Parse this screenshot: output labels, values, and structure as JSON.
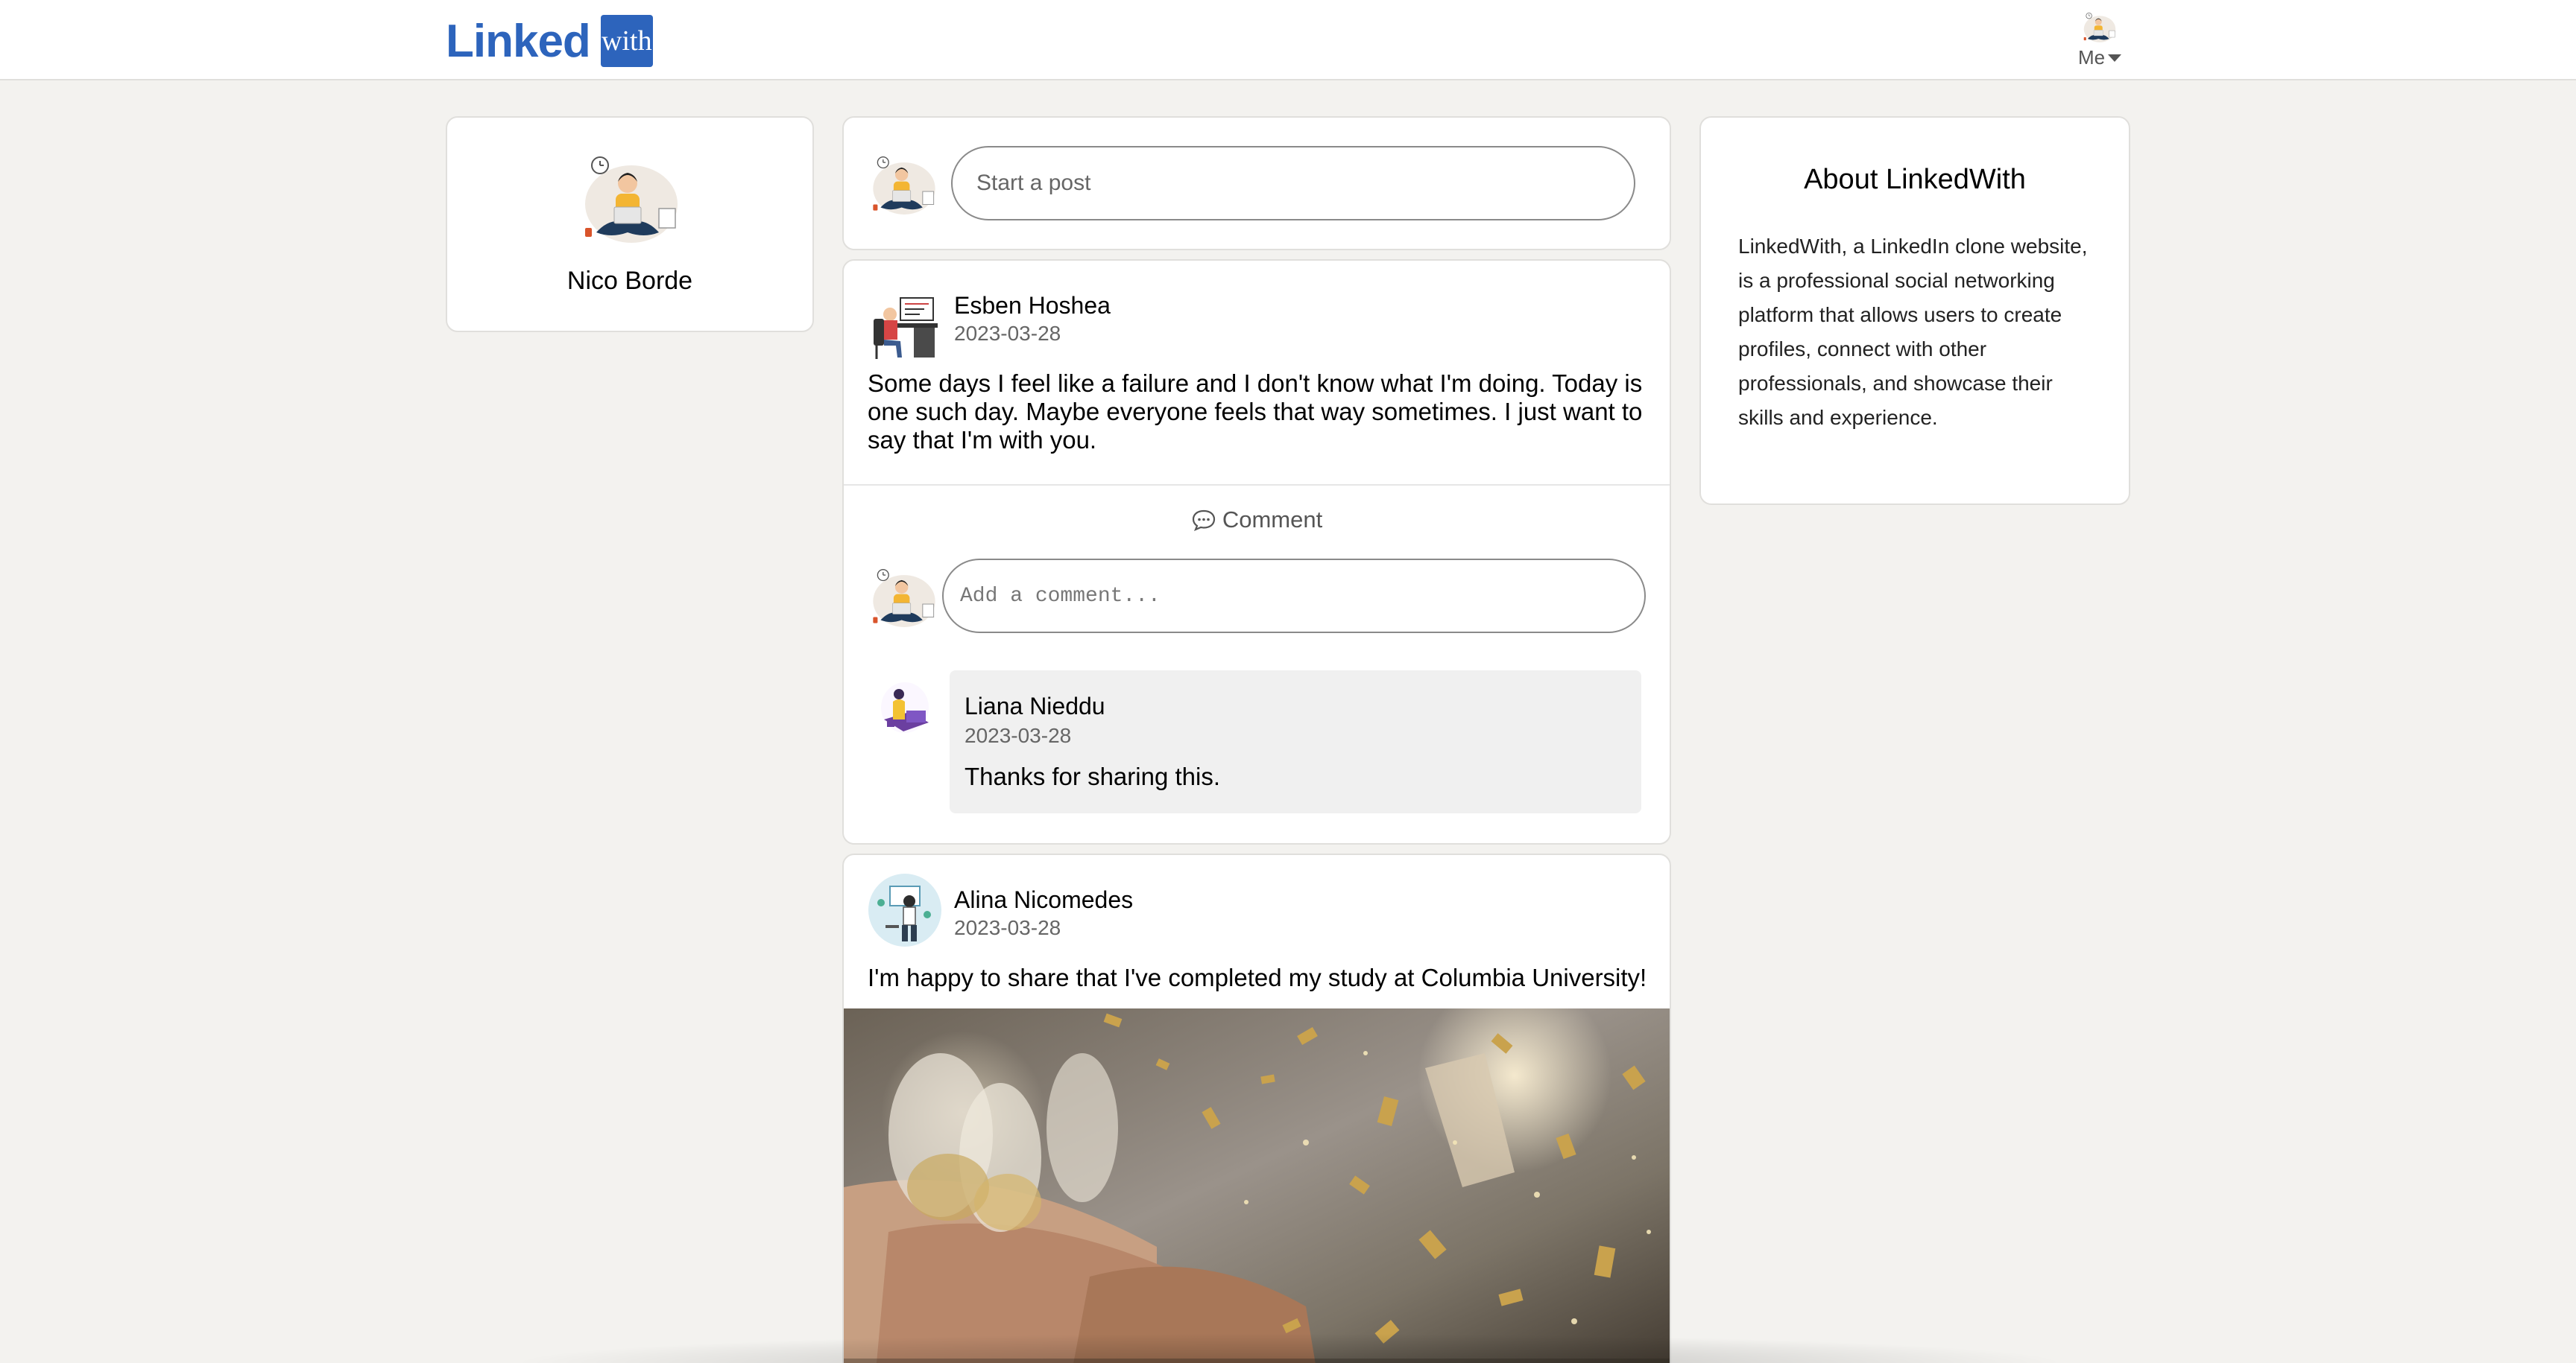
{
  "header": {
    "logo_word": "Linked",
    "logo_box": "with",
    "me_label": "Me",
    "me_icon": "caret-down-icon"
  },
  "profile": {
    "name": "Nico Borde"
  },
  "composer": {
    "placeholder": "Start a post"
  },
  "about": {
    "title": "About LinkedWith",
    "text": "LinkedWith, a LinkedIn clone website, is a professional social networking platform that allows users to create profiles, connect with other professionals, and showcase their skills and experience."
  },
  "posts": [
    {
      "author": "Esben Hoshea",
      "date": "2023-03-28",
      "body": "Some days I feel like a failure and I don't know what I'm doing. Today is one such day. Maybe everyone feels that way sometimes. I just want to say that I'm with you.",
      "comment_label": "Comment",
      "comment_icon": "speech-bubble-icon",
      "comment_placeholder": "Add a comment...",
      "comments": [
        {
          "author": "Liana Nieddu",
          "date": "2023-03-28",
          "text": "Thanks for sharing this."
        }
      ]
    },
    {
      "author": "Alina Nicomedes",
      "date": "2023-03-28",
      "body": "I'm happy to share that I've completed my study at Columbia University!"
    }
  ],
  "colors": {
    "brand": "#2d64bc",
    "background": "#f3f2ef",
    "card": "#ffffff"
  }
}
